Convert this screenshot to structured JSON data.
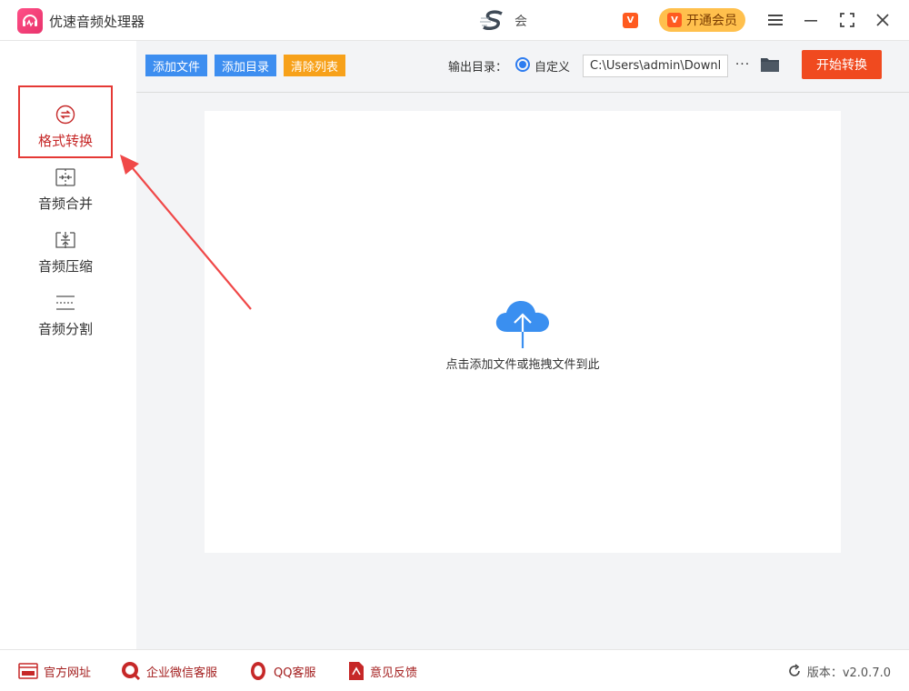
{
  "app": {
    "title": "优速音频处理器",
    "user_name": "会",
    "vip_badge": "V",
    "vip_button_label": "开通会员"
  },
  "sidebar": {
    "items": [
      {
        "label": "格式转换",
        "icon": "format-convert-icon",
        "active": true
      },
      {
        "label": "音频合并",
        "icon": "merge-icon",
        "active": false
      },
      {
        "label": "音频压缩",
        "icon": "compress-icon",
        "active": false
      },
      {
        "label": "音频分割",
        "icon": "split-icon",
        "active": false
      }
    ]
  },
  "toolbar": {
    "add_file": "添加文件",
    "add_folder": "添加目录",
    "clear_list": "清除列表",
    "output_label": "输出目录：",
    "custom_option": "自定义",
    "output_path": "C:\\Users\\admin\\Downlc",
    "more": "···",
    "start_button": "开始转换"
  },
  "dropzone": {
    "hint": "点击添加文件或拖拽文件到此",
    "icon": "cloud-upload-icon"
  },
  "statusbar": {
    "links": [
      {
        "label": "官方网址",
        "icon": "website-icon"
      },
      {
        "label": "企业微信客服",
        "icon": "wecom-icon"
      },
      {
        "label": "QQ客服",
        "icon": "qq-icon"
      },
      {
        "label": "意见反馈",
        "icon": "feedback-icon"
      }
    ],
    "version": "版本：v2.0.7.0"
  },
  "colors": {
    "accent_blue": "#3d8ef0",
    "accent_orange": "#f7a11a",
    "start_red": "#f04a1f",
    "vip_gold": "#ffc04d",
    "highlight_red": "#e53935"
  }
}
